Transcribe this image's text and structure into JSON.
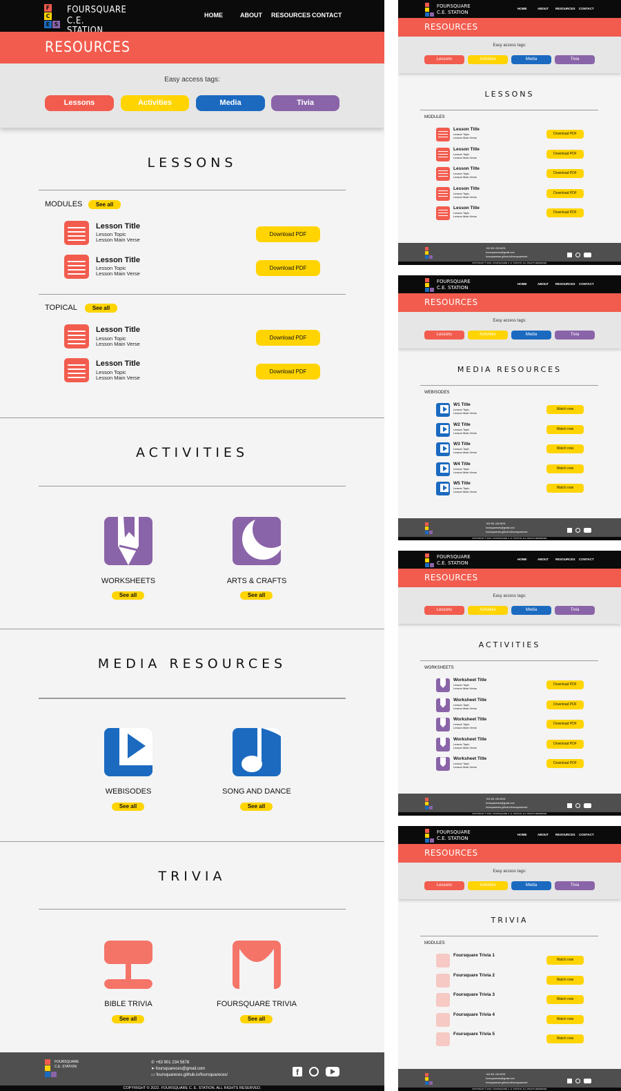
{
  "brand": {
    "name_line1": "FOURSQUARE",
    "name_line2": "C.E. STATION",
    "logo_letters": [
      "F",
      "C",
      "E",
      "S"
    ],
    "logo_colors": [
      "#f25c4e",
      "#ffd400",
      "#1b6ac0",
      "#8a64a8"
    ]
  },
  "nav": {
    "home": "HOME",
    "about": "ABOUT",
    "resources": "RESOURCES",
    "contact": "CONTACT"
  },
  "banner": {
    "title": "RESOURCES"
  },
  "tags": {
    "label": "Easy access tags:",
    "items": [
      {
        "label": "Lessons",
        "color": "#f25c4e"
      },
      {
        "label": "Activities",
        "color": "#ffd400"
      },
      {
        "label": "Media",
        "color": "#1b6ac0"
      },
      {
        "label": "Tivia",
        "color": "#8a64a8"
      }
    ]
  },
  "lessons": {
    "title": "LESSONS",
    "modules_label": "MODULES",
    "topical_label": "TOPICAL",
    "see_all": "See all",
    "item_title": "Lesson Title",
    "item_topic": "Lesson Topic",
    "item_verse": "Lesson Main Verse",
    "download": "Download PDF"
  },
  "activities": {
    "title": "ACTIVITIES",
    "worksheets": "WORKSHEETS",
    "arts": "ARTS & CRAFTS",
    "see_all": "See all"
  },
  "media": {
    "title": "MEDIA RESOURCES",
    "webisodes": "WEBISODES",
    "song": "SONG AND DANCE",
    "see_all": "See all"
  },
  "trivia": {
    "title": "TRIVIA",
    "bible": "BIBLE TRIVIA",
    "foursquare": "FOURSQUARE TRIVIA",
    "see_all": "See all"
  },
  "footer": {
    "phone": "+63 901 234 5678",
    "email": "foursquareces@gmail.com",
    "site": "foursquareces.github.io/foursquareces/",
    "copyright": "COPYRIGHT © 2022. FOURSQUARE C. E. STATION. ALL RIGHTS RESERVED."
  },
  "thumbs": {
    "lessons": {
      "title": "LESSONS",
      "sub": "MODULES",
      "button": "Download PDF",
      "items": [
        "Lesson Title",
        "Lesson Title",
        "Lesson Title",
        "Lesson Title",
        "Lesson Title"
      ]
    },
    "media": {
      "title": "MEDIA RESOURCES",
      "sub": "WEBISODES",
      "button": "Watch now",
      "items": [
        "W1 Title",
        "W2 Title",
        "W3 Title",
        "W4 Title",
        "W5 Title"
      ]
    },
    "activities": {
      "title": "ACTIVITIES",
      "sub": "WORKSHEETS",
      "button": "Download PDF",
      "items": [
        "Worksheet Title",
        "Worksheet Title",
        "Worksheet Title",
        "Worksheet Title",
        "Worksheet Title"
      ]
    },
    "trivia": {
      "title": "TRIVIA",
      "sub": "MODULES",
      "button": "Watch now",
      "items": [
        "Foursquare Trivia 1",
        "Foursquare Trivia 2",
        "Foursquare Trivia 3",
        "Foursquare Trivia 4",
        "Foursquare Trivia 5"
      ]
    }
  }
}
